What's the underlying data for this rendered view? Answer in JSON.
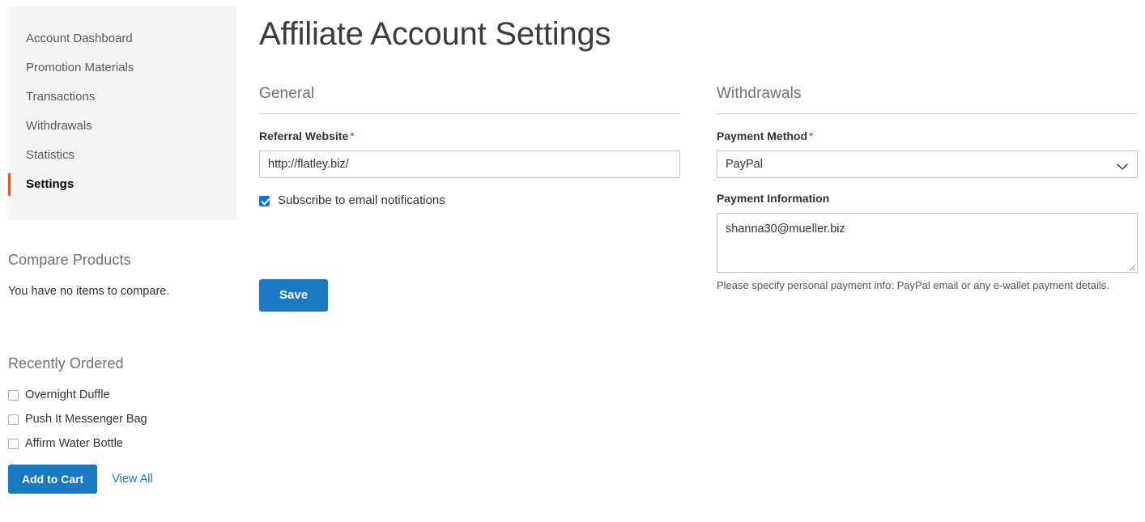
{
  "page": {
    "title": "Affiliate Account Settings"
  },
  "sidebar": {
    "nav_items": [
      {
        "label": "Account Dashboard",
        "current": false
      },
      {
        "label": "Promotion Materials",
        "current": false
      },
      {
        "label": "Transactions",
        "current": false
      },
      {
        "label": "Withdrawals",
        "current": false
      },
      {
        "label": "Statistics",
        "current": false
      },
      {
        "label": "Settings",
        "current": true
      }
    ],
    "compare": {
      "title": "Compare Products",
      "empty_text": "You have no items to compare."
    },
    "recently_ordered": {
      "title": "Recently Ordered",
      "items": [
        {
          "label": "Overnight Duffle",
          "checked": false
        },
        {
          "label": "Push It Messenger Bag",
          "checked": false
        },
        {
          "label": "Affirm Water Bottle",
          "checked": false
        }
      ],
      "add_to_cart_label": "Add to Cart",
      "view_all_label": "View All"
    }
  },
  "general": {
    "legend": "General",
    "referral_website": {
      "label": "Referral Website",
      "required_marker": "*",
      "value": "http://flatley.biz/",
      "placeholder": ""
    },
    "subscribe": {
      "label": "Subscribe to email notifications",
      "checked": true
    }
  },
  "withdrawals": {
    "legend": "Withdrawals",
    "payment_method": {
      "label": "Payment Method",
      "required_marker": "*",
      "selected": "PayPal",
      "options": [
        "PayPal"
      ]
    },
    "payment_information": {
      "label": "Payment Information",
      "value": "shanna30@mueller.biz",
      "placeholder": "",
      "note": "Please specify personal payment info: PayPal email or any e-wallet payment details."
    }
  },
  "actions": {
    "save_label": "Save"
  },
  "colors": {
    "primary_blue": "#1979c3",
    "checkbox_blue": "#0b72e8",
    "accent_orange": "#ff5501",
    "required_red": "#e02b27",
    "sidebar_bg": "#f5f5f5",
    "muted_text": "#6e716e"
  }
}
